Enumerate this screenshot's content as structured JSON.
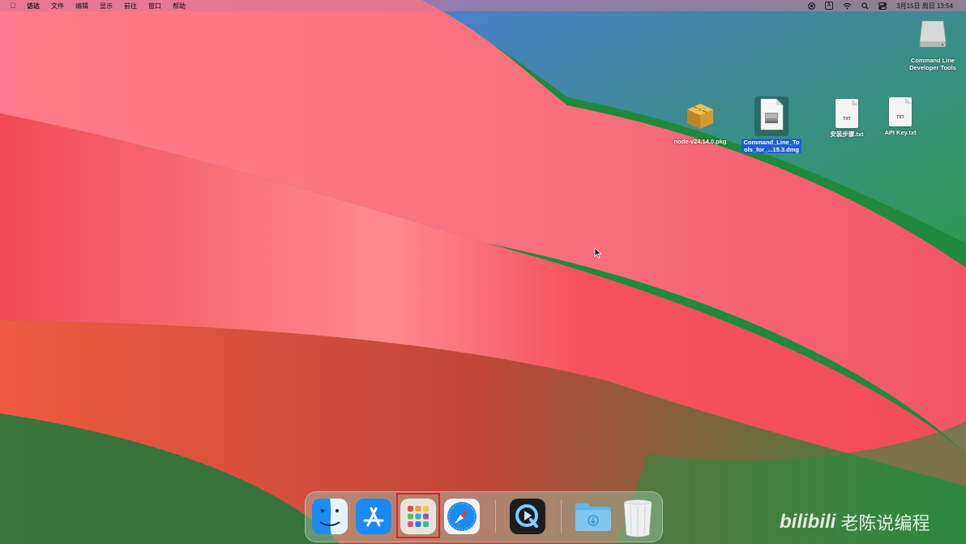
{
  "menubar": {
    "app_name": "访达",
    "menus": [
      "文件",
      "编辑",
      "显示",
      "前往",
      "窗口",
      "帮助"
    ],
    "ime_label": "A",
    "datetime": "3月15日 周日 13:54"
  },
  "desktop": {
    "items": [
      {
        "label": "Command Line\nDeveloper Tools",
        "kind": "disk"
      },
      {
        "label": "node-v24.14.0.pkg",
        "kind": "pkg"
      },
      {
        "label": "Command_Line_Tools_for_...15.3.dmg",
        "label_line1": "Command_Line_To",
        "label_line2": "ols_for_...15.3.dmg",
        "kind": "dmg",
        "selected": true
      },
      {
        "label": "安装步骤.txt",
        "kind": "txt",
        "badge": "TXT"
      },
      {
        "label": "API Key.txt",
        "kind": "txt",
        "badge": "TXT"
      }
    ]
  },
  "dock": {
    "apps": [
      "Finder",
      "App Store",
      "Launchpad",
      "Safari",
      "QuickTime Player",
      "Downloads",
      "Trash"
    ],
    "highlighted": "Launchpad",
    "highlight_color": "#e01f26"
  },
  "watermark": {
    "brand": "bilibili",
    "text": "老陈说编程"
  }
}
